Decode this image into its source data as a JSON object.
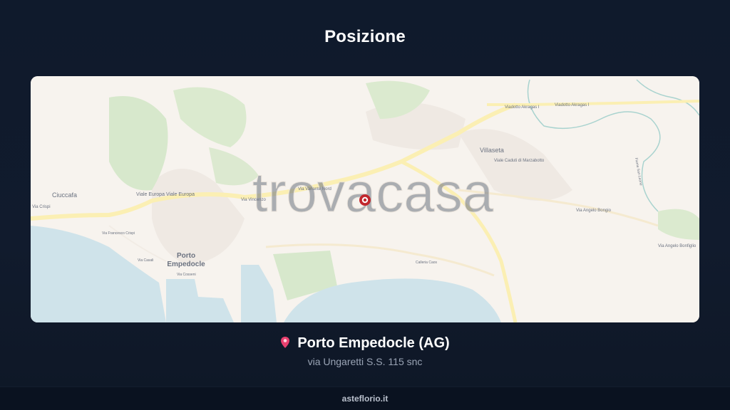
{
  "header": {
    "title": "Posizione"
  },
  "map": {
    "watermark": "trovacasa",
    "labels": {
      "ciuccafa": "Ciuccafa",
      "porto_line1": "Porto",
      "porto_line2": "Empedocle",
      "villaseta": "Villaseta",
      "viale_europa_1": "Viale Europa",
      "viale_europa_2": "Viale Europa",
      "via_vincenzo": "Via Vincenzo",
      "via_variante_nord": "Via Variante Nord",
      "viadotto_1": "Viadotto Akragas I",
      "viadotto_2": "Viadotto Akragas I",
      "viale_cadutti": "Viale Caduti di Marzabotto",
      "via_angelo_1": "Via Angelo Bongio",
      "via_angelo_2": "Via Angelo Bonfiglio",
      "via_crispi": "Via Crispi",
      "via_fr_crispi": "Via Francesco Crispi",
      "via_casali": "Via Casali",
      "via_cosseni": "Via Cosseni",
      "calleria_caos": "Calleria Caos",
      "fiume": "Fiume San Leone"
    },
    "colors": {
      "sea": "#cfe3ea",
      "land": "#f7f3ee",
      "green": "#d7e8cc",
      "road": "#fbefb3",
      "pin": "#c1272d"
    }
  },
  "location": {
    "pin_icon": "map-pin-icon",
    "name": "Porto Empedocle (AG)",
    "address": "via Ungaretti S.S. 115 snc"
  },
  "footer": {
    "site": "asteflorio.it"
  }
}
